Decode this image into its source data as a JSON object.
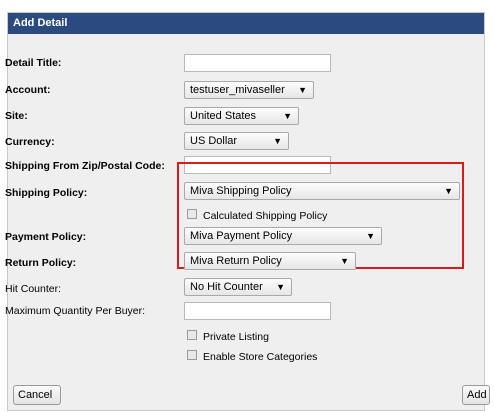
{
  "dialog": {
    "title": "Add Detail"
  },
  "form": {
    "detail_title": {
      "label": "Detail Title:",
      "value": ""
    },
    "account": {
      "label": "Account:",
      "value": "testuser_mivaseller"
    },
    "site": {
      "label": "Site:",
      "value": "United States"
    },
    "currency": {
      "label": "Currency:",
      "value": "US Dollar"
    },
    "zip": {
      "label": "Shipping From Zip/Postal Code:",
      "value": ""
    },
    "shipping_policy": {
      "label": "Shipping Policy:",
      "value": "Miva Shipping Policy"
    },
    "calculated_shipping": {
      "label": "Calculated Shipping Policy",
      "checked": false
    },
    "payment_policy": {
      "label": "Payment Policy:",
      "value": "Miva Payment Policy"
    },
    "return_policy": {
      "label": "Return Policy:",
      "value": "Miva Return Policy"
    },
    "hit_counter": {
      "label": "Hit Counter:",
      "value": "No Hit Counter"
    },
    "max_quantity": {
      "label": "Maximum Quantity Per Buyer:",
      "value": ""
    },
    "private_listing": {
      "label": "Private Listing",
      "checked": false
    },
    "store_categories": {
      "label": "Enable Store Categories",
      "checked": false
    }
  },
  "buttons": {
    "cancel": "Cancel",
    "add": "Add"
  },
  "icons": {
    "dropdown_arrow": "▼"
  },
  "colors": {
    "header_bg": "#2b4a7e",
    "highlight_border": "#d81b1b"
  }
}
